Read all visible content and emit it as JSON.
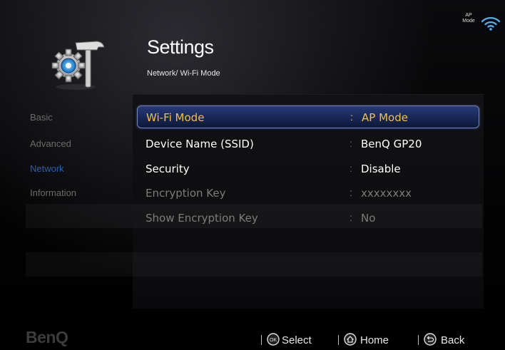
{
  "status": {
    "ap_line1": "AP",
    "ap_line2": "Mode"
  },
  "header": {
    "title": "Settings",
    "breadcrumb": "Network/ Wi-Fi Mode"
  },
  "sidebar": {
    "items": [
      {
        "label": "Basic",
        "active": false
      },
      {
        "label": "Advanced",
        "active": false
      },
      {
        "label": "Network",
        "active": true
      },
      {
        "label": "Information",
        "active": false
      }
    ]
  },
  "settings": {
    "rows": [
      {
        "label": "Wi-Fi Mode",
        "value": "AP Mode",
        "state": "selected"
      },
      {
        "label": "Device Name (SSID)",
        "value": "BenQ GP20",
        "state": "normal"
      },
      {
        "label": "Security",
        "value": "Disable",
        "state": "normal"
      },
      {
        "label": "Encryption Key",
        "value": "xxxxxxxx",
        "state": "dim"
      },
      {
        "label": "Show Encryption Key",
        "value": "No",
        "state": "dim"
      }
    ],
    "colon": ":"
  },
  "footer": {
    "brand": "BenQ",
    "select_label": "Select",
    "ok_icon_text": "OK",
    "home_label": "Home",
    "back_label": "Back"
  },
  "colors": {
    "highlight_text": "#f3c044",
    "selection_fill": "#1a2a5a",
    "active_menu": "#2f5fa6"
  }
}
